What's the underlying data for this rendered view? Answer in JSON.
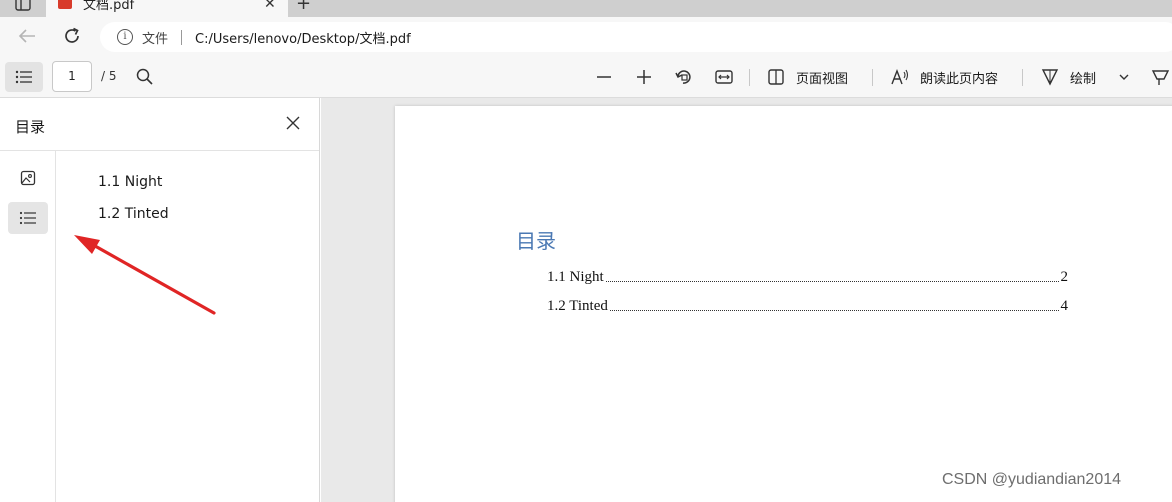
{
  "tab": {
    "title": "文档.pdf",
    "close_glyph": "✕",
    "new_tab_glyph": "+"
  },
  "address": {
    "site_label": "文件",
    "url": "C:/Users/lenovo/Desktop/文档.pdf"
  },
  "toolbar": {
    "page_current": "1",
    "page_total": "/ 5",
    "page_view_label": "页面视图",
    "read_aloud_label": "朗读此页内容",
    "draw_label": "绘制"
  },
  "sidebar": {
    "title": "目录",
    "toc": [
      {
        "label": "1.1 Night"
      },
      {
        "label": "1.2 Tinted"
      }
    ]
  },
  "document": {
    "heading": "目录",
    "entries": [
      {
        "label": "1.1 Night",
        "page": "2"
      },
      {
        "label": "1.2 Tinted",
        "page": "4"
      }
    ]
  },
  "watermark": "CSDN @yudiandian2014",
  "colors": {
    "heading_blue": "#4a78b3",
    "annotation_arrow": "#e02525"
  }
}
